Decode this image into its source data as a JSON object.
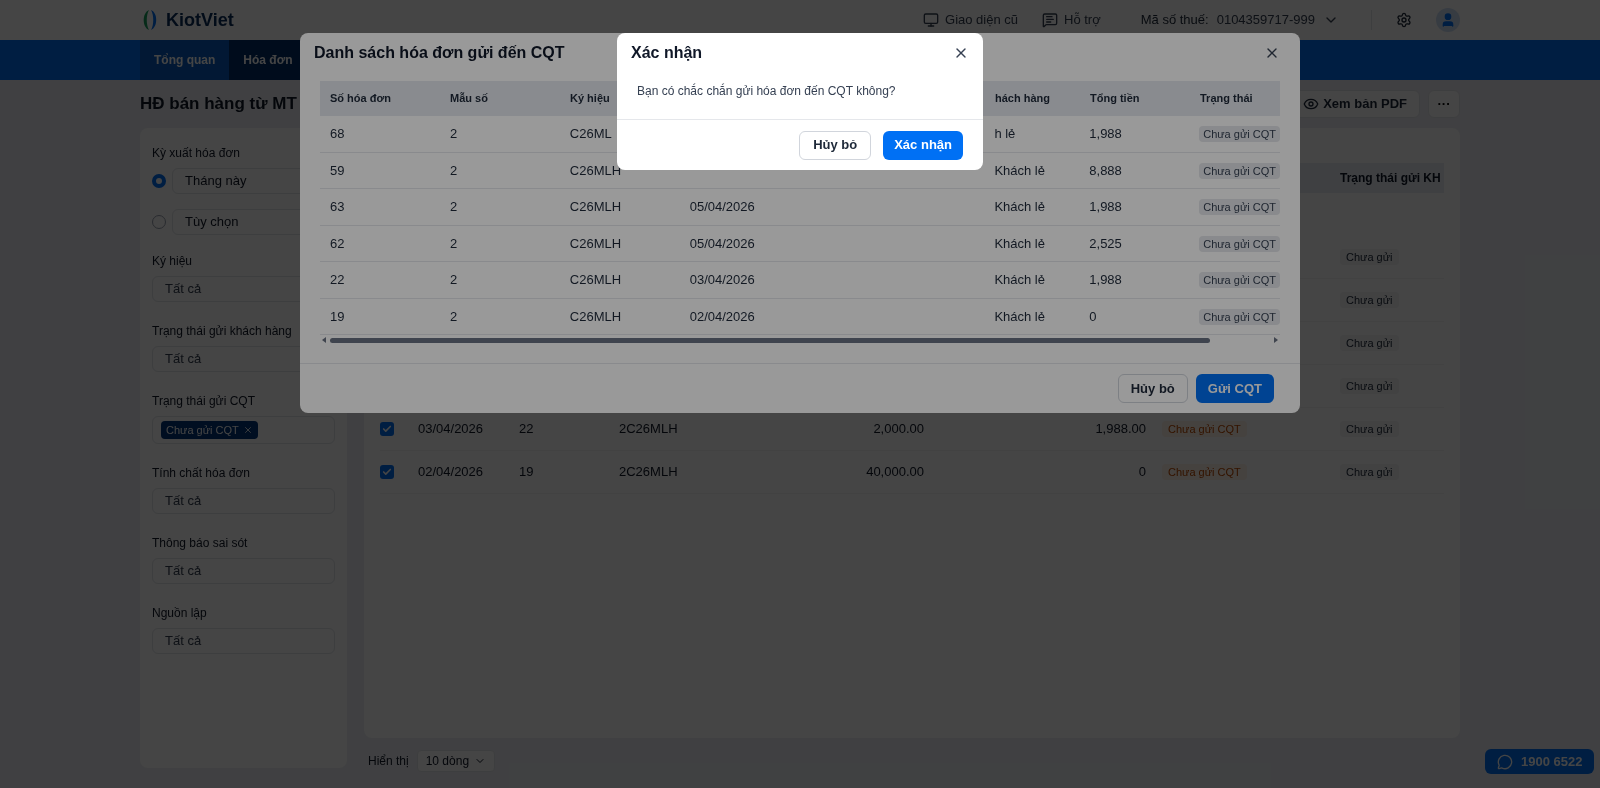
{
  "header": {
    "logo": "KiotViet",
    "links": [
      {
        "kind": "monitor",
        "label": "Giao diện cũ"
      },
      {
        "kind": "chat",
        "label": "Hỗ trợ"
      }
    ],
    "tax_label": "Mã số thuế:",
    "tax_value": "0104359717-999"
  },
  "nav": [
    {
      "label": "Tổng quan",
      "selected": false
    },
    {
      "label": "Hóa đơn",
      "selected": true
    }
  ],
  "page_title": "HĐ bán hàng từ MT",
  "actions": {
    "pdf": "Xem bản PDF",
    "more": "···"
  },
  "filters": [
    {
      "kind": "radio",
      "label": "Kỳ xuất hóa đơn",
      "options": [
        {
          "label": "Tháng này",
          "selected": true
        },
        {
          "label": "Tùy chọn",
          "selected": false
        }
      ]
    },
    {
      "kind": "select",
      "label": "Ký hiệu",
      "placeholder": "Tất cả"
    },
    {
      "kind": "select",
      "label": "Trạng thái gửi khách hàng",
      "placeholder": "Tất cả"
    },
    {
      "kind": "tags",
      "label": "Trạng thái gửi CQT",
      "tags": [
        "Chưa gửi CQT"
      ]
    },
    {
      "kind": "select",
      "label": "Tính chất hóa đơn",
      "placeholder": "Tất cả"
    },
    {
      "kind": "select",
      "label": "Thông báo sai sót",
      "placeholder": "Tất cả"
    },
    {
      "kind": "select",
      "label": "Nguồn lập",
      "placeholder": "Tất cả"
    }
  ],
  "main_table": {
    "last_column_header": "Trạng thái gửi KH",
    "rows": [
      {
        "customer_status": "Chưa gửi"
      },
      {
        "customer_status": "Chưa gửi"
      },
      {
        "customer_status": "Chưa gửi"
      },
      {
        "customer_status": "Chưa gửi"
      },
      {
        "checked": true,
        "date": "03/04/2026",
        "number": "22",
        "symbol": "2C26MLH",
        "amount": "2,000.00",
        "total": "1,988.00",
        "status": "Chưa gửi CQT",
        "customer_status": "Chưa gửi"
      },
      {
        "checked": true,
        "date": "02/04/2026",
        "number": "19",
        "symbol": "2C26MLH",
        "amount": "40,000.00",
        "total": "0",
        "status": "Chưa gửi CQT",
        "customer_status": "Chưa gửi"
      }
    ]
  },
  "pagination": {
    "label": "Hiển thị",
    "value": "10 dòng"
  },
  "hotline": "1900 6522",
  "invoice_dialog": {
    "title": "Danh sách hóa đơn gửi đến CQT",
    "columns": [
      "Số hóa đơn",
      "Mẫu số",
      "Ký hiệu",
      "",
      "",
      "hách hàng",
      "Tổng tiền",
      "Trạng thái"
    ],
    "rows": [
      {
        "number": "68",
        "template": "2",
        "symbol": "C26ML",
        "customer": "h lẻ",
        "total": "1,988",
        "status": "Chưa gửi CQT"
      },
      {
        "number": "59",
        "template": "2",
        "symbol": "C26MLH",
        "customer": "Khách lẻ",
        "total": "8,888",
        "status": "Chưa gửi CQT"
      },
      {
        "number": "63",
        "template": "2",
        "symbol": "C26MLH",
        "date": "05/04/2026",
        "customer": "Khách lẻ",
        "total": "1,988",
        "status": "Chưa gửi CQT"
      },
      {
        "number": "62",
        "template": "2",
        "symbol": "C26MLH",
        "date": "05/04/2026",
        "customer": "Khách lẻ",
        "total": "2,525",
        "status": "Chưa gửi CQT"
      },
      {
        "number": "22",
        "template": "2",
        "symbol": "C26MLH",
        "date": "03/04/2026",
        "customer": "Khách lẻ",
        "total": "1,988",
        "status": "Chưa gửi CQT"
      },
      {
        "number": "19",
        "template": "2",
        "symbol": "C26MLH",
        "date": "02/04/2026",
        "customer": "Khách lẻ",
        "total": "0",
        "status": "Chưa gửi CQT"
      }
    ],
    "cancel": "Hủy bỏ",
    "submit": "Gửi CQT"
  },
  "confirm_dialog": {
    "title": "Xác nhận",
    "message": "Bạn có chắc chắn gửi hóa đơn đến CQT không?",
    "cancel": "Hủy bỏ",
    "confirm": "Xác nhận"
  }
}
